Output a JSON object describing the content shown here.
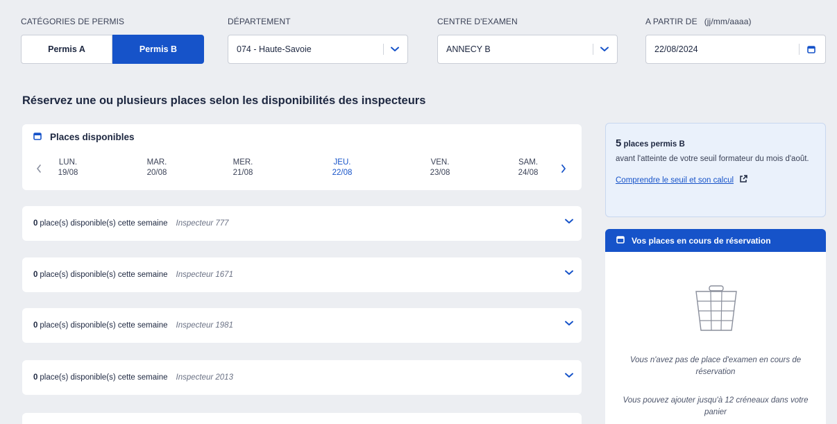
{
  "filters": {
    "categories": {
      "label": "CATÉGORIES DE PERMIS",
      "options": [
        "Permis A",
        "Permis B"
      ],
      "selected": "Permis B"
    },
    "departement": {
      "label": "DÉPARTEMENT",
      "value": "074 - Haute-Savoie"
    },
    "centre": {
      "label": "CENTRE D'EXAMEN",
      "value": "ANNECY B"
    },
    "date": {
      "label": "A PARTIR DE",
      "hint": "(jj/mm/aaaa)",
      "value": "22/08/2024"
    }
  },
  "heading": "Réservez une ou plusieurs places selon les disponibilités des inspecteurs",
  "places": {
    "title": "Places disponibles",
    "days": [
      {
        "name": "LUN.",
        "date": "19/08",
        "active": false
      },
      {
        "name": "MAR.",
        "date": "20/08",
        "active": false
      },
      {
        "name": "MER.",
        "date": "21/08",
        "active": false
      },
      {
        "name": "JEU.",
        "date": "22/08",
        "active": true
      },
      {
        "name": "VEN.",
        "date": "23/08",
        "active": false
      },
      {
        "name": "SAM.",
        "date": "24/08",
        "active": false
      }
    ]
  },
  "inspectors": [
    {
      "count": "0",
      "text": "place(s) disponible(s) cette semaine",
      "name": "Inspecteur 777"
    },
    {
      "count": "0",
      "text": "place(s) disponible(s) cette semaine",
      "name": "Inspecteur 1671"
    },
    {
      "count": "0",
      "text": "place(s) disponible(s) cette semaine",
      "name": "Inspecteur 1981"
    },
    {
      "count": "0",
      "text": "place(s) disponible(s) cette semaine",
      "name": "Inspecteur 2013"
    }
  ],
  "seuil": {
    "count": "5",
    "count_label": "places permis B",
    "text": "avant l'atteinte de votre seuil formateur du mois d'août.",
    "link": "Comprendre le seuil et son calcul"
  },
  "basket": {
    "title": "Vos places en cours de réservation",
    "empty_text": "Vous n'avez pas de place d'examen en cours de réservation",
    "limit_text": "Vous pouvez ajouter jusqu'à 12 créneaux dans votre panier"
  },
  "colors": {
    "primary": "#1653c9",
    "background": "#eceef2",
    "info_bg": "#eaf1fb"
  },
  "icons": [
    "calendar-icon",
    "chevron-down-icon",
    "chevron-left-icon",
    "chevron-right-icon",
    "external-link-icon",
    "basket-icon"
  ]
}
